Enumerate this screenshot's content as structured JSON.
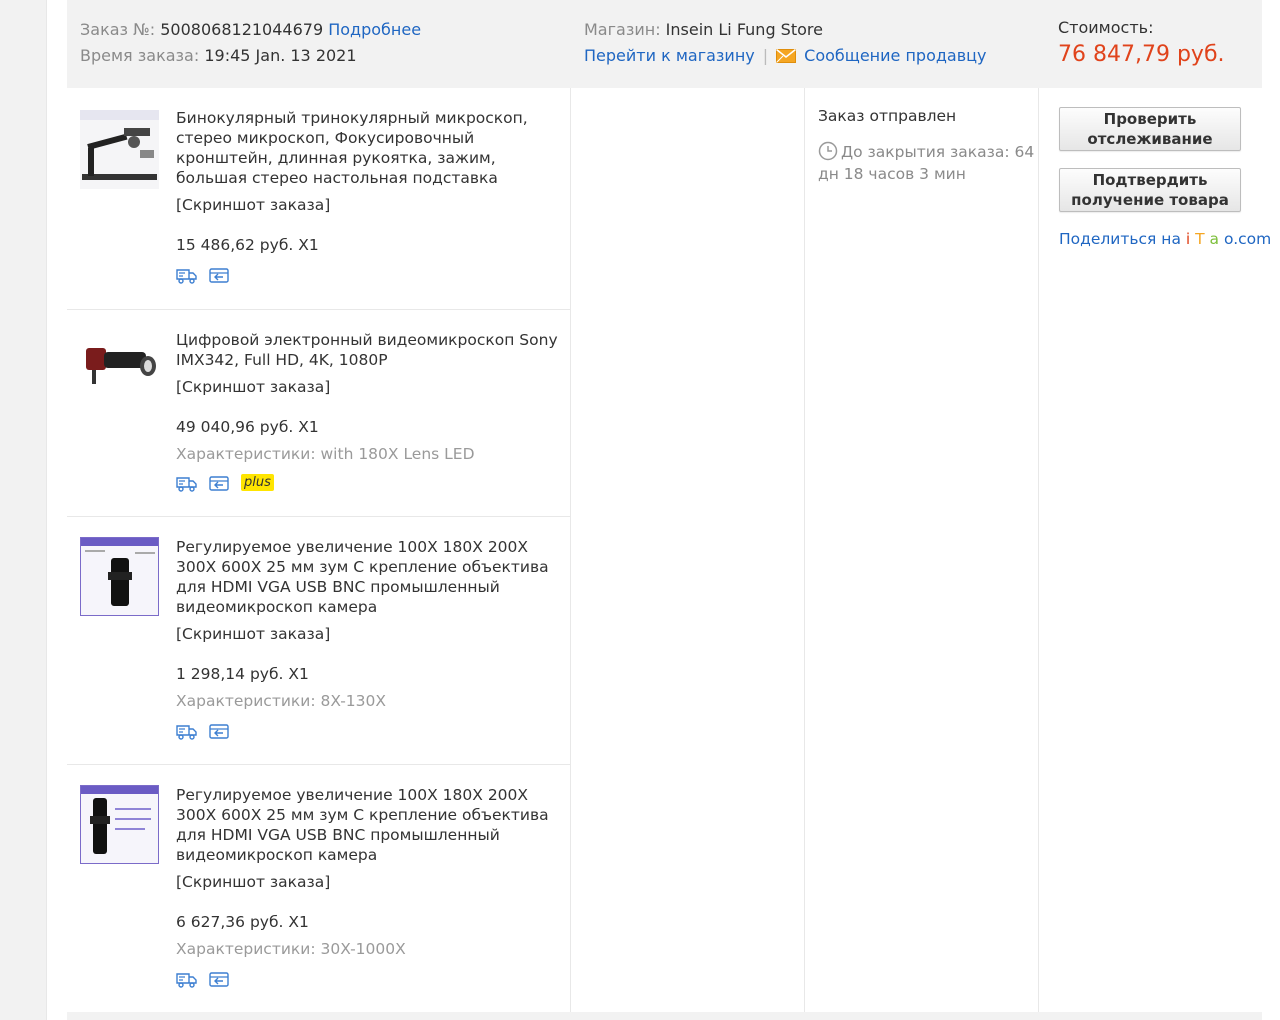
{
  "header": {
    "order_no_label": "Заказ №:",
    "order_no": "5008068121044679",
    "details_link": "Подробнее",
    "order_time_label": "Время заказа:",
    "order_time": "19:45 Jan. 13 2021",
    "store_label": "Магазин:",
    "store_name": "Insein Li Fung Store",
    "go_to_store": "Перейти к магазину",
    "separator": "|",
    "message_seller": "Сообщение продавцу",
    "cost_label": "Стоимость:",
    "cost_value": "76 847,79 руб."
  },
  "items": [
    {
      "title": "Бинокулярный тринокулярный микроскоп, стерео микроскоп, Фокусировочный кронштейн, длинная рукоятка, зажим, большая стерео настольная подставка",
      "snapshot": "[Скриншот заказа]",
      "price": "15 486,62 руб. X1",
      "specs": ""
    },
    {
      "title": "Цифровой электронный видеомикроскоп Sony IMX342, Full HD, 4K, 1080P",
      "snapshot": "[Скриншот заказа]",
      "price": "49 040,96 руб. X1",
      "specs": "Характеристики: with 180X Lens LED",
      "badge": "plus"
    },
    {
      "title": "Регулируемое увеличение 100X 180X 200X 300X 600X 25 мм зум С крепление объектива для HDMI VGA USB BNC промышленный видеомикроскоп камера",
      "snapshot": "[Скриншот заказа]",
      "price": "1 298,14 руб. X1",
      "specs": "Характеристики: 8X-130X"
    },
    {
      "title": "Регулируемое увеличение 100X 180X 200X 300X 600X 25 мм зум С крепление объектива для HDMI VGA USB BNC промышленный видеомикроскоп камера",
      "snapshot": "[Скриншот заказа]",
      "price": "6 627,36 руб. X1",
      "specs": "Характеристики: 30X-1000X"
    }
  ],
  "status": {
    "title": "Заказ отправлен",
    "time_left": "До закрытия заказа: 64 дн 18 часов 3 мин"
  },
  "actions": {
    "check_tracking": "Проверить отслеживание",
    "confirm_receipt": "Подтвердить получение товара",
    "share_prefix": "Поделиться на ",
    "share_i": "i",
    "share_t": "T",
    "share_a": "a",
    "share_o": "o",
    "share_suffix": ".com"
  },
  "colors": {
    "link": "#1f66c2",
    "price_red": "#e0431b",
    "header_bg": "#f2f2f2",
    "plus_badge": "#ffe500"
  },
  "icons": [
    "truck-icon",
    "return-box-icon",
    "mail-envelope-icon",
    "clock-icon"
  ]
}
